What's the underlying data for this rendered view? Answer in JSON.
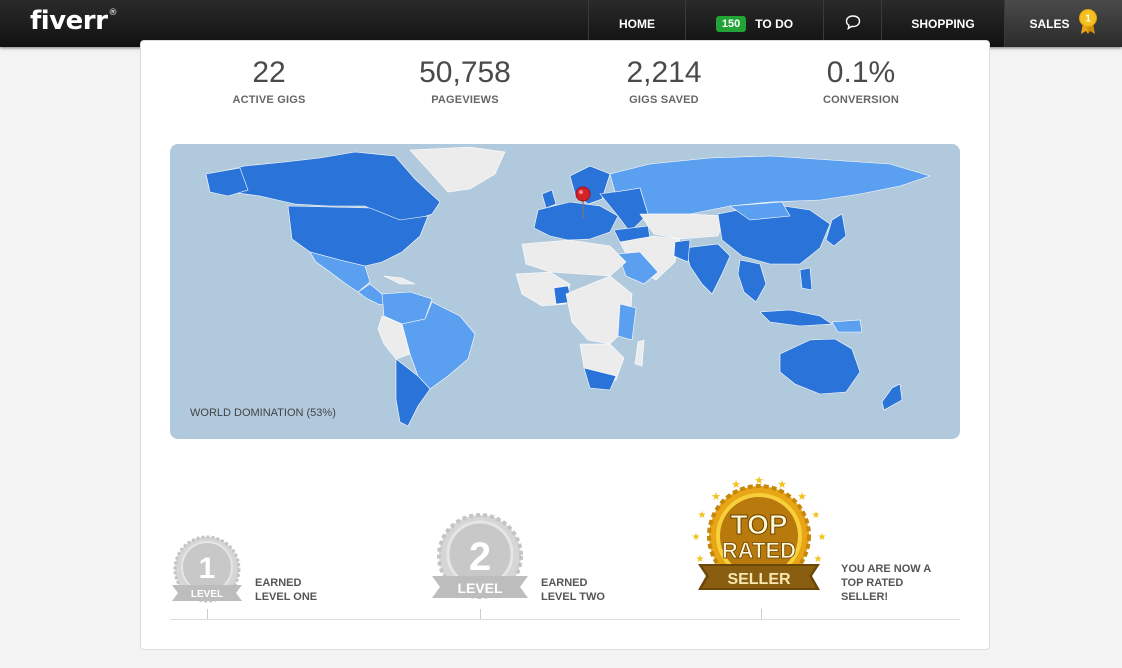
{
  "brand": {
    "logo_text": "fiverr",
    "registered": "®"
  },
  "nav": {
    "home": "HOME",
    "todo_count": "150",
    "todo": "TO DO",
    "messages_icon": "speech-bubble-icon",
    "shopping": "SHOPPING",
    "sales": "SALES",
    "sales_badge_icon": "award-ribbon-icon",
    "sales_badge_count": "1"
  },
  "stats": [
    {
      "value": "22",
      "label": "ACTIVE GIGS"
    },
    {
      "value": "50,758",
      "label": "PAGEVIEWS"
    },
    {
      "value": "2,214",
      "label": "GIGS SAVED"
    },
    {
      "value": "0.1%",
      "label": "CONVERSION"
    }
  ],
  "map": {
    "label": "WORLD DOMINATION (53%)",
    "colors": {
      "ocean": "#b1c9dd",
      "dark": "#2a74d9",
      "light": "#5a9ff0",
      "none": "#ececec"
    },
    "pin_icon": "map-pin-icon"
  },
  "levels": [
    {
      "badge_number": "1",
      "badge_word": "LEVEL",
      "line1": "EARNED",
      "line2": "LEVEL ONE",
      "line3": ""
    },
    {
      "badge_number": "2",
      "badge_word": "LEVEL",
      "line1": "EARNED",
      "line2": "LEVEL TWO",
      "line3": ""
    },
    {
      "badge_top": "TOP",
      "badge_rated": "RATED",
      "badge_seller": "SELLER",
      "line1": "YOU ARE NOW A",
      "line2": "TOP RATED",
      "line3": "SELLER!"
    }
  ]
}
